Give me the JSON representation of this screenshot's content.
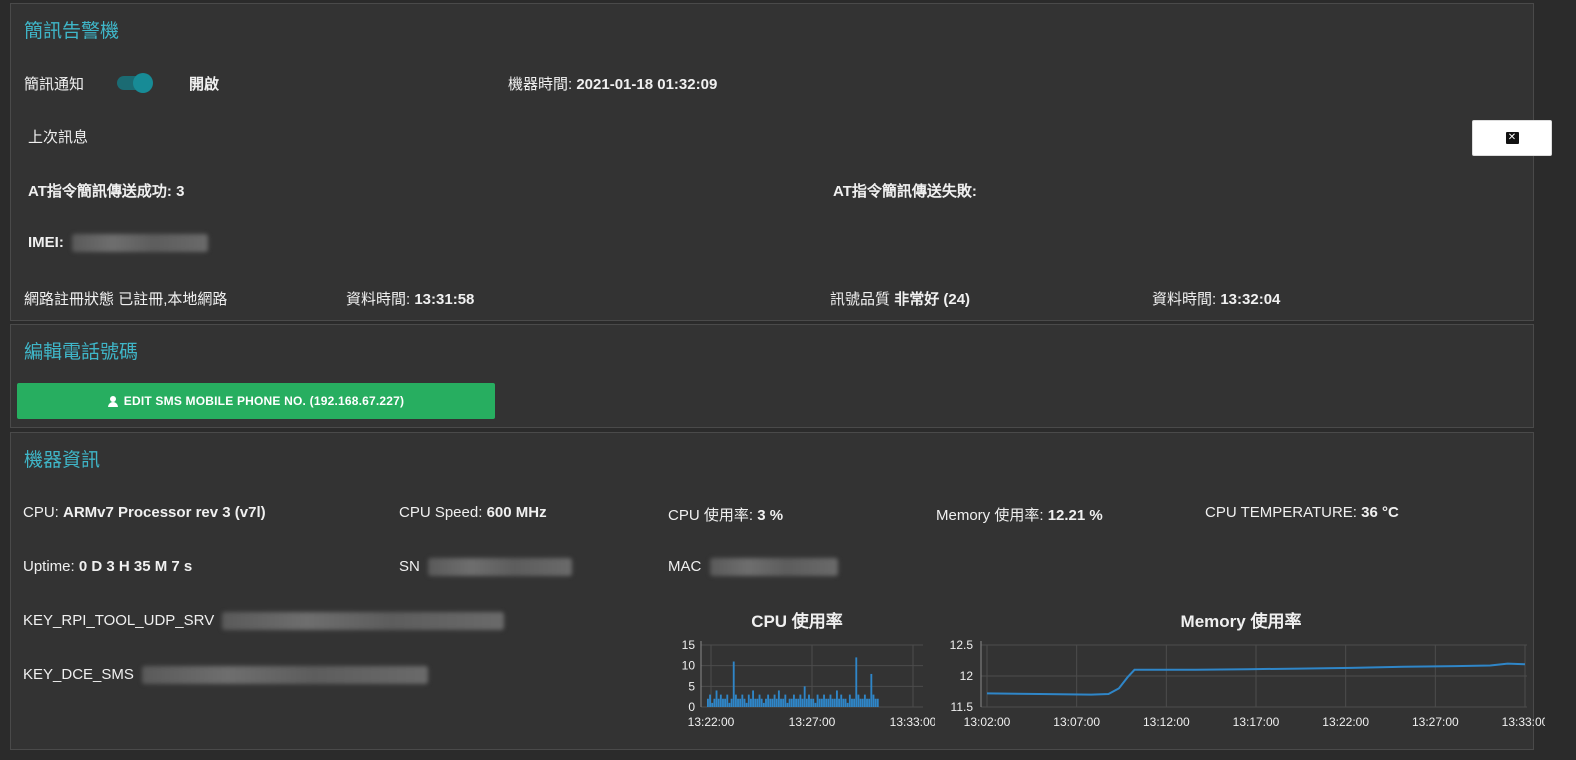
{
  "sms_panel": {
    "title": "簡訊告警機",
    "notify_label": "簡訊通知",
    "toggle_state": "開啟",
    "machine_time_label": "機器時間:",
    "machine_time_value": "2021-01-18 01:32:09",
    "last_message_label": "上次訊息",
    "at_success_label": "AT指令簡訊傳送成功:",
    "at_success_value": "3",
    "at_fail_label": "AT指令簡訊傳送失敗:",
    "imei_label": "IMEI:",
    "net_reg_label": "網路註冊狀態",
    "net_reg_value": "已註冊,本地網路",
    "data_time_label_1": "資料時間:",
    "data_time_value_1": "13:31:58",
    "signal_label": "訊號品質",
    "signal_value": "非常好 (24)",
    "data_time_label_2": "資料時間:",
    "data_time_value_2": "13:32:04"
  },
  "phone_panel": {
    "title": "編輯電話號碼",
    "edit_button": "EDIT SMS MOBILE PHONE NO. (192.168.67.227)"
  },
  "info_panel": {
    "title": "機器資訊",
    "cpu_label": "CPU:",
    "cpu_value": "ARMv7 Processor rev 3 (v7l)",
    "cpu_speed_label": "CPU Speed:",
    "cpu_speed_value": "600 MHz",
    "cpu_usage_label": "CPU 使用率:",
    "cpu_usage_value": "3 %",
    "mem_usage_label": "Memory 使用率:",
    "mem_usage_value": "12.21 %",
    "cpu_temp_label": "CPU TEMPERATURE:",
    "cpu_temp_value": "36 °C",
    "uptime_label": "Uptime:",
    "uptime_value": "0 D 3 H 35 M 7 s",
    "sn_label": "SN",
    "mac_label": "MAC",
    "key1_label": "KEY_RPI_TOOL_UDP_SRV",
    "key2_label": "KEY_DCE_SMS"
  },
  "colors": {
    "accent": "#3fb6c8",
    "button": "#27ae60",
    "line": "#2f86c8",
    "toggle": "#178b96"
  },
  "chart_data": [
    {
      "type": "bar",
      "title": "CPU 使用率",
      "ylim": [
        0,
        15
      ],
      "yticks": [
        "15",
        "10",
        "5",
        "0"
      ],
      "xticks": [
        "13:22:00",
        "13:27:00",
        "13:33:00"
      ],
      "x_range_min": [
        0,
        11
      ],
      "series": [
        {
          "values": [
            2,
            3,
            1,
            2,
            4,
            2,
            3,
            2,
            2,
            3,
            1,
            2,
            11,
            3,
            2,
            2,
            3,
            2,
            1,
            3,
            2,
            4,
            2,
            2,
            3,
            2,
            1,
            2,
            3,
            2,
            2,
            3,
            2,
            4,
            2,
            2,
            3,
            1,
            2,
            2,
            3,
            2,
            2,
            3,
            2,
            5,
            2,
            3,
            2,
            2,
            1,
            3,
            2,
            2,
            3,
            2,
            2,
            3,
            2,
            2,
            4,
            2,
            3,
            2,
            2,
            1,
            3,
            2,
            2,
            12,
            3,
            2,
            2,
            3,
            2,
            2,
            8,
            3,
            2,
            2
          ]
        }
      ]
    },
    {
      "type": "line",
      "title": "Memory 使用率",
      "ylim": [
        11.5,
        12.5
      ],
      "yticks": [
        "12.5",
        "12",
        "11.5"
      ],
      "xticks": [
        "13:02:00",
        "13:07:00",
        "13:12:00",
        "13:17:00",
        "13:22:00",
        "13:27:00",
        "13:33:00"
      ],
      "x": [
        0,
        3,
        6,
        7,
        7.6,
        8.1,
        8.5,
        9,
        9.5,
        12,
        15,
        18,
        21,
        24,
        27,
        29,
        30,
        31
      ],
      "series": [
        {
          "values": [
            11.72,
            11.71,
            11.7,
            11.71,
            11.8,
            11.98,
            12.1,
            12.1,
            12.1,
            12.1,
            12.11,
            12.12,
            12.13,
            12.15,
            12.16,
            12.17,
            12.2,
            12.19
          ]
        }
      ]
    }
  ]
}
